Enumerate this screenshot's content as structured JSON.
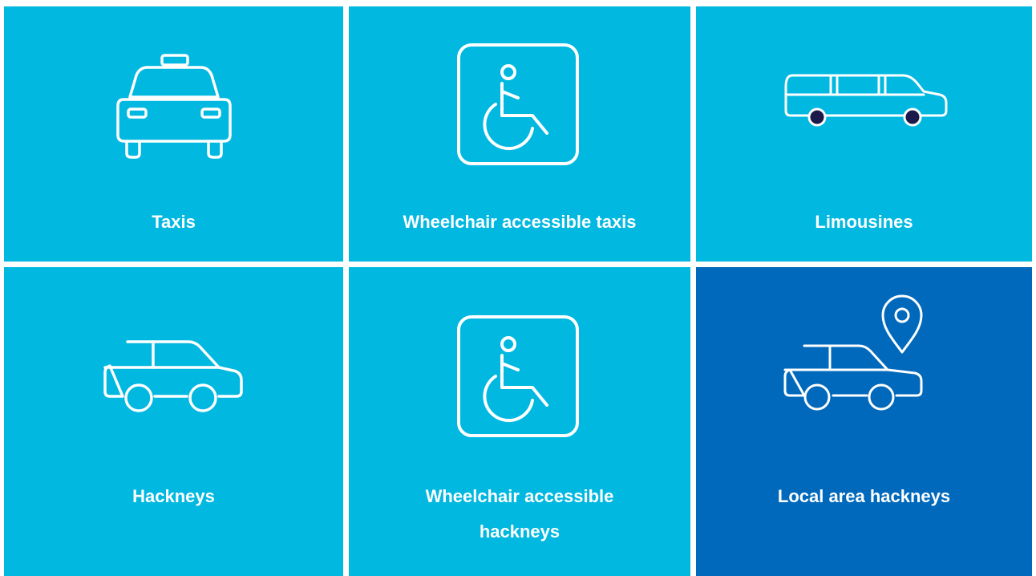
{
  "colors": {
    "tile_bg": "#00B8E0",
    "tile_active_bg": "#0069BC",
    "text": "#FFFFFF",
    "wheel_dark": "#1B1A4A"
  },
  "tiles": [
    {
      "label": "Taxis",
      "icon": "taxi-icon",
      "active": false
    },
    {
      "label": "Wheelchair accessible taxis",
      "icon": "wheelchair-icon",
      "active": false
    },
    {
      "label": "Limousines",
      "icon": "limousine-icon",
      "active": false
    },
    {
      "label": "Hackneys",
      "icon": "car-icon",
      "active": false
    },
    {
      "label": "Wheelchair accessible hackneys",
      "icon": "wheelchair-icon",
      "active": false
    },
    {
      "label": "Local area hackneys",
      "icon": "car-location-icon",
      "active": true
    }
  ]
}
